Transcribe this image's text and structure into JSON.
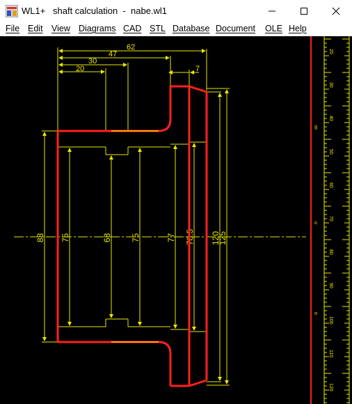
{
  "window": {
    "app_name": "WL1+",
    "title": "shaft calculation  -  nabe.wl1",
    "controls": [
      "minimize-icon",
      "maximize-icon",
      "close-icon"
    ]
  },
  "menu": [
    "File",
    "Edit",
    "View",
    "Diagrams",
    "CAD",
    "STL",
    "Database",
    "Document",
    "OLE",
    "Help"
  ],
  "drawing": {
    "horizontal_dims": [
      "62",
      "47",
      "30",
      "20",
      "7"
    ],
    "vertical_dims": [
      "88",
      "75",
      "68",
      "75",
      "77",
      "78.5",
      "120",
      "125"
    ],
    "colors": {
      "outline": "#ff2020",
      "dimension": "#e8e800",
      "background": "#000000",
      "ruler_bg": "#000000"
    }
  },
  "ruler": {
    "labels": [
      "20",
      "30",
      "40",
      "50",
      "60",
      "70",
      "80",
      "90",
      "100",
      "110",
      "120"
    ],
    "side_labels": [
      "m",
      "m",
      "u",
      "u",
      "o",
      "o"
    ]
  }
}
